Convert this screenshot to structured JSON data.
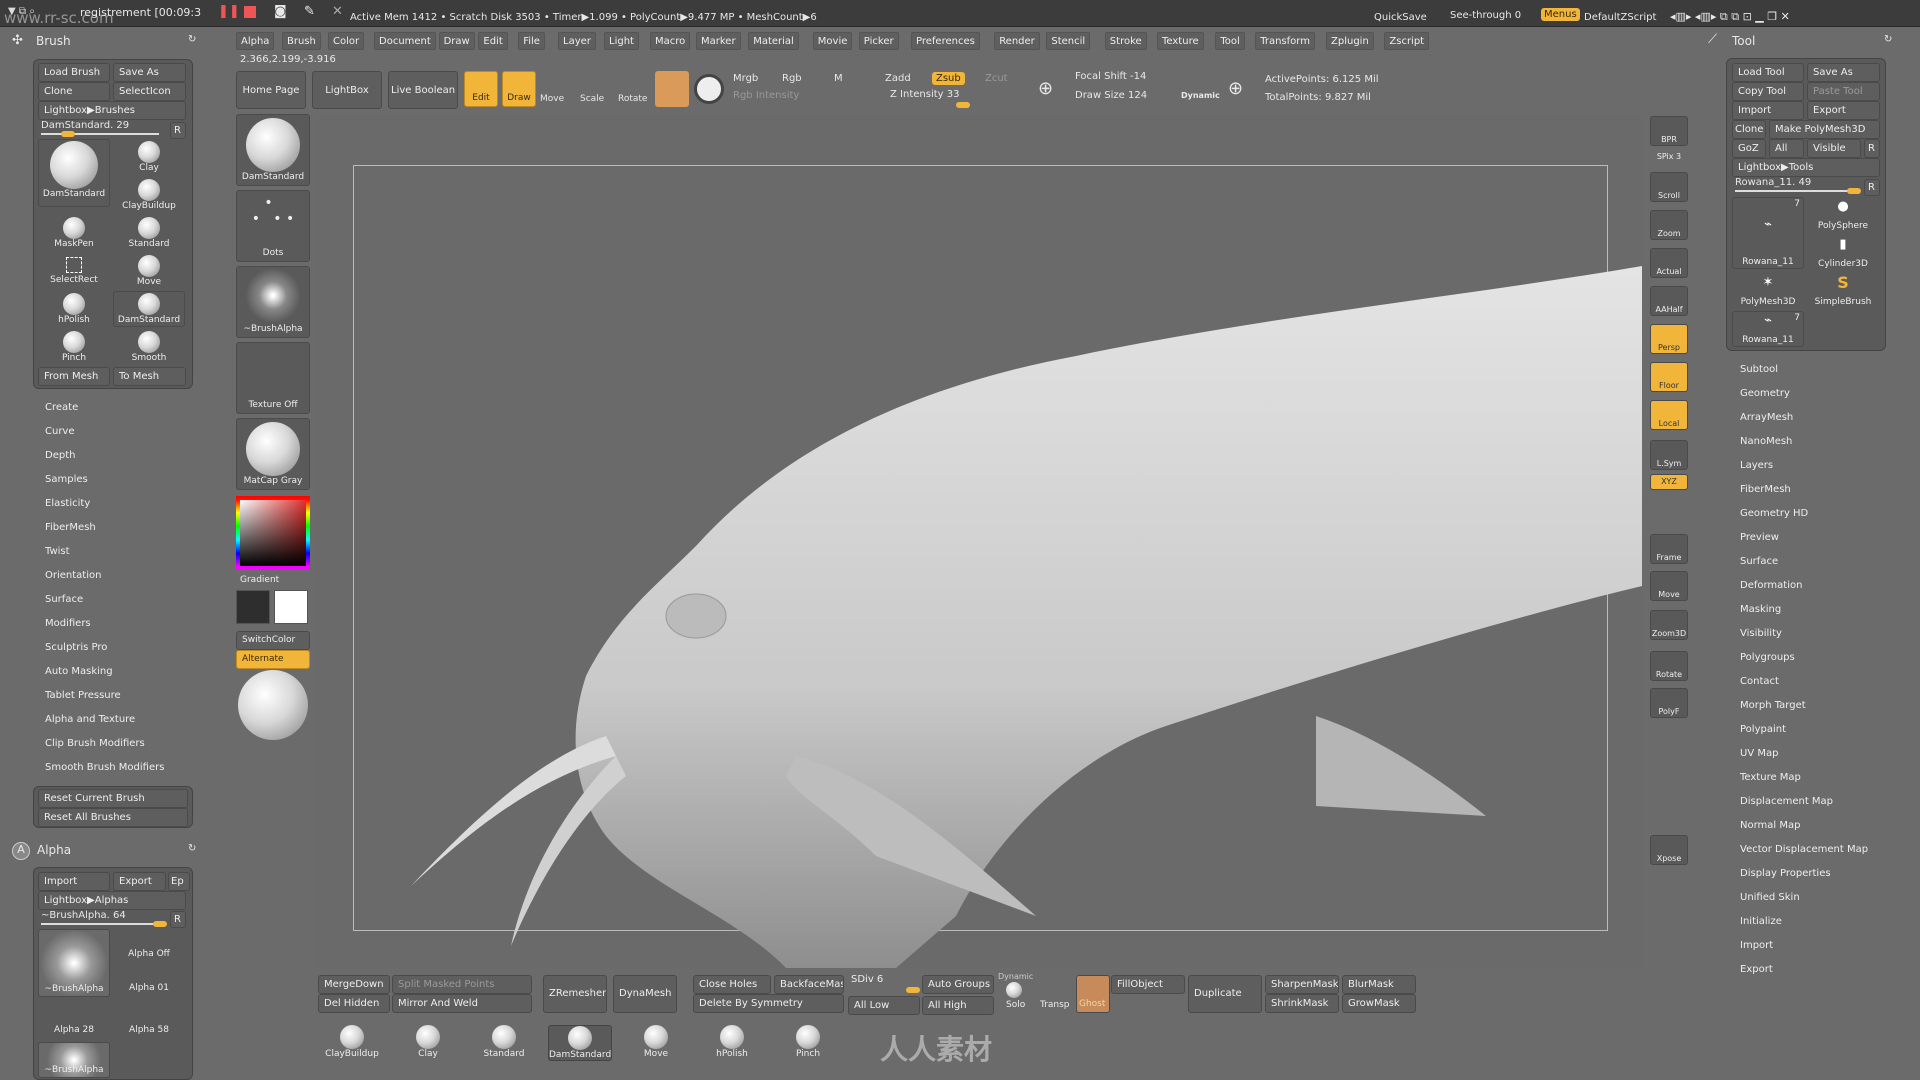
{
  "recorder": {
    "title": "registrement [00:09:3",
    "watermark": "www.rr-sc.com"
  },
  "status": {
    "text": "Active Mem 1412 • Scratch Disk 3503 • Timer▶1.099 • PolyCount▶9.477 MP • MeshCount▶6"
  },
  "topright": {
    "quicksave": "QuickSave",
    "see_through": "See-through  0",
    "menus": "Menus",
    "script": "DefaultZScript"
  },
  "menubar": [
    "Alpha",
    "Brush",
    "Color",
    "Document",
    "Draw",
    "Edit",
    "File",
    "Layer",
    "Light",
    "Macro",
    "Marker",
    "Material",
    "Movie",
    "Picker",
    "Preferences",
    "Render",
    "Stencil",
    "Stroke",
    "Texture",
    "Tool",
    "Transform",
    "Zplugin",
    "Zscript"
  ],
  "coords": "2.366,2.199,-3.916",
  "toolbar": {
    "home": "Home Page",
    "lightbox": "LightBox",
    "live_boolean": "Live Boolean",
    "edit": "Edit",
    "draw": "Draw",
    "move": "Move",
    "scale": "Scale",
    "rotate": "Rotate",
    "mrgb": "Mrgb",
    "rgb": "Rgb",
    "m": "M",
    "rgb_intensity": "Rgb Intensity",
    "zadd": "Zadd",
    "zsub": "Zsub",
    "zcut": "Zcut",
    "z_intensity": "Z Intensity 33",
    "focal_shift": "Focal Shift -14",
    "draw_size": "Draw Size 124",
    "dynamic": "Dynamic",
    "active_points": "ActivePoints: 6.125 Mil",
    "total_points": "TotalPoints: 9.827 Mil"
  },
  "brush_panel": {
    "title": "Brush",
    "load": "Load Brush",
    "save_as": "Save As",
    "clone": "Clone",
    "select_icon": "SelectIcon",
    "lightbox": "Lightbox▶Brushes",
    "slider": "DamStandard. 29",
    "r": "R",
    "brushes": [
      "DamStandard",
      "Clay",
      "ClayBuildup",
      "MaskPen",
      "Standard",
      "SelectRect",
      "Move",
      "hPolish",
      "DamStandard",
      "Pinch",
      "Smooth"
    ],
    "from_mesh": "From Mesh",
    "to_mesh": "To Mesh",
    "sections": [
      "Create",
      "Curve",
      "Depth",
      "Samples",
      "Elasticity",
      "FiberMesh",
      "Twist",
      "Orientation",
      "Surface",
      "Modifiers",
      "Sculptris Pro",
      "Auto Masking",
      "Tablet Pressure",
      "Alpha and Texture",
      "Clip Brush Modifiers",
      "Smooth Brush Modifiers"
    ],
    "reset_current": "Reset Current Brush",
    "reset_all": "Reset All Brushes"
  },
  "alpha_panel": {
    "title": "Alpha",
    "import": "Import",
    "export": "Export",
    "ep": "Ep",
    "lightbox": "Lightbox▶Alphas",
    "slider": "~BrushAlpha. 64",
    "r": "R",
    "alphas": [
      "~BrushAlpha",
      "Alpha Off",
      "Alpha 01",
      "Alpha 28",
      "Alpha 58",
      "~BrushAlpha"
    ]
  },
  "left_shelf": {
    "brush": "DamStandard",
    "stroke": "Dots",
    "alpha": "~BrushAlpha",
    "texture": "Texture Off",
    "material": "MatCap Gray",
    "gradient": "Gradient",
    "switch": "SwitchColor",
    "alternate": "Alternate"
  },
  "right_shelf": [
    "BPR",
    "SPix 3",
    "Scroll",
    "Zoom",
    "Actual",
    "AAHalf",
    "Persp",
    "Floor",
    "Local",
    "L.Sym",
    "XYZ",
    "Frame",
    "Move",
    "Zoom3D",
    "Rotate",
    "PolyF",
    "Xpose"
  ],
  "tool_panel": {
    "title": "Tool",
    "load": "Load Tool",
    "save_as": "Save As",
    "copy": "Copy Tool",
    "paste": "Paste Tool",
    "import": "Import",
    "export": "Export",
    "clone": "Clone",
    "make_polymesh": "Make PolyMesh3D",
    "goz": "GoZ",
    "all": "All",
    "visible": "Visible",
    "r": "R",
    "lightbox": "Lightbox▶Tools",
    "slider": "Rowana_11. 49",
    "tools": [
      {
        "name": "Rowana_11",
        "count": "7"
      },
      {
        "name": "PolySphere"
      },
      {
        "name": "Cylinder3D"
      },
      {
        "name": "PolyMesh3D"
      },
      {
        "name": "SimpleBrush"
      },
      {
        "name": "Rowana_11",
        "count": "7"
      }
    ],
    "sections": [
      "Subtool",
      "Geometry",
      "ArrayMesh",
      "NanoMesh",
      "Layers",
      "FiberMesh",
      "Geometry HD",
      "Preview",
      "Surface",
      "Deformation",
      "Masking",
      "Visibility",
      "Polygroups",
      "Contact",
      "Morph Target",
      "Polypaint",
      "UV Map",
      "Texture Map",
      "Displacement Map",
      "Normal Map",
      "Vector Displacement Map",
      "Display Properties",
      "Unified Skin",
      "Initialize",
      "Import",
      "Export"
    ]
  },
  "bottom": {
    "merge_down": "MergeDown",
    "split": "Split Masked Points",
    "del_hidden": "Del Hidden",
    "mirror_weld": "Mirror And Weld",
    "zremesher": "ZRemesher",
    "dynamesh": "DynaMesh",
    "close_holes": "Close Holes",
    "backface": "BackfaceMask",
    "delete_sym": "Delete By Symmetry",
    "sdiv": "SDiv 6",
    "all_low": "All Low",
    "auto_groups": "Auto Groups",
    "all_high": "All High",
    "dynamic": "Dynamic",
    "solo": "Solo",
    "transp": "Transp",
    "ghost": "Ghost",
    "fill": "FillObject",
    "duplicate": "Duplicate",
    "sharpen": "SharpenMask",
    "blur": "BlurMask",
    "shrink": "ShrinkMask",
    "grow": "GrowMask",
    "brushes": [
      "ClayBuildup",
      "Clay",
      "Standard",
      "DamStandard",
      "Move",
      "hPolish",
      "Pinch"
    ],
    "logo": "人人素材"
  },
  "colors": {
    "accent": "#f1b53a",
    "bg": "#6b6b6b",
    "panel": "#5a5a5a"
  }
}
